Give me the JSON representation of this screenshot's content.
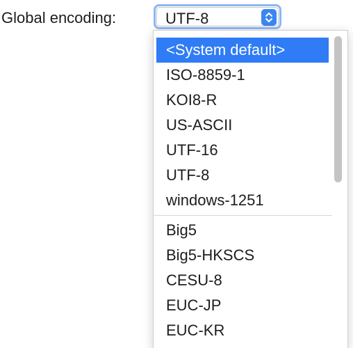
{
  "encoding": {
    "label": "Global encoding:",
    "selected_value": "UTF-8"
  },
  "dropdown": {
    "primary_items": [
      {
        "label": "<System default>",
        "highlighted": true
      },
      {
        "label": "ISO-8859-1"
      },
      {
        "label": "KOI8-R"
      },
      {
        "label": "US-ASCII"
      },
      {
        "label": "UTF-16"
      },
      {
        "label": "UTF-8"
      },
      {
        "label": "windows-1251"
      }
    ],
    "other_items": [
      {
        "label": "Big5"
      },
      {
        "label": "Big5-HKSCS"
      },
      {
        "label": "CESU-8"
      },
      {
        "label": "EUC-JP"
      },
      {
        "label": "EUC-KR"
      }
    ]
  },
  "colors": {
    "highlight": "#2f7cf6",
    "focus_ring": "#8db6f5",
    "stepper": "#3a86f2"
  },
  "icons": {
    "stepper": "chevron-up-down-icon"
  }
}
